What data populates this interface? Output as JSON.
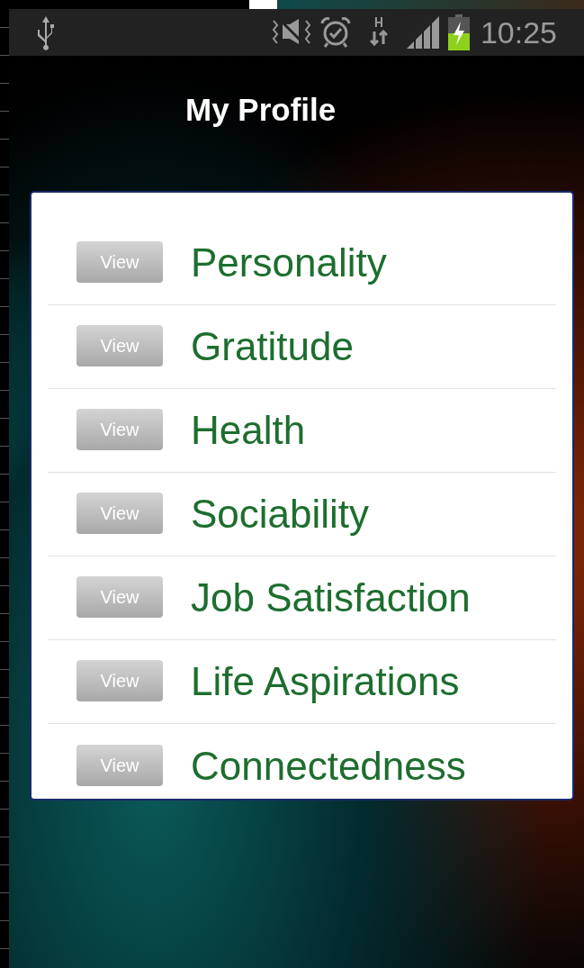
{
  "status_bar": {
    "network_type": "H",
    "time": "10:25"
  },
  "title": "My Profile",
  "items": [
    {
      "button": "View",
      "label": "Personality"
    },
    {
      "button": "View",
      "label": "Gratitude"
    },
    {
      "button": "View",
      "label": "Health"
    },
    {
      "button": "View",
      "label": "Sociability"
    },
    {
      "button": "View",
      "label": "Job Satisfaction"
    },
    {
      "button": "View",
      "label": "Life Aspirations"
    },
    {
      "button": "View",
      "label": "Connectedness"
    }
  ]
}
